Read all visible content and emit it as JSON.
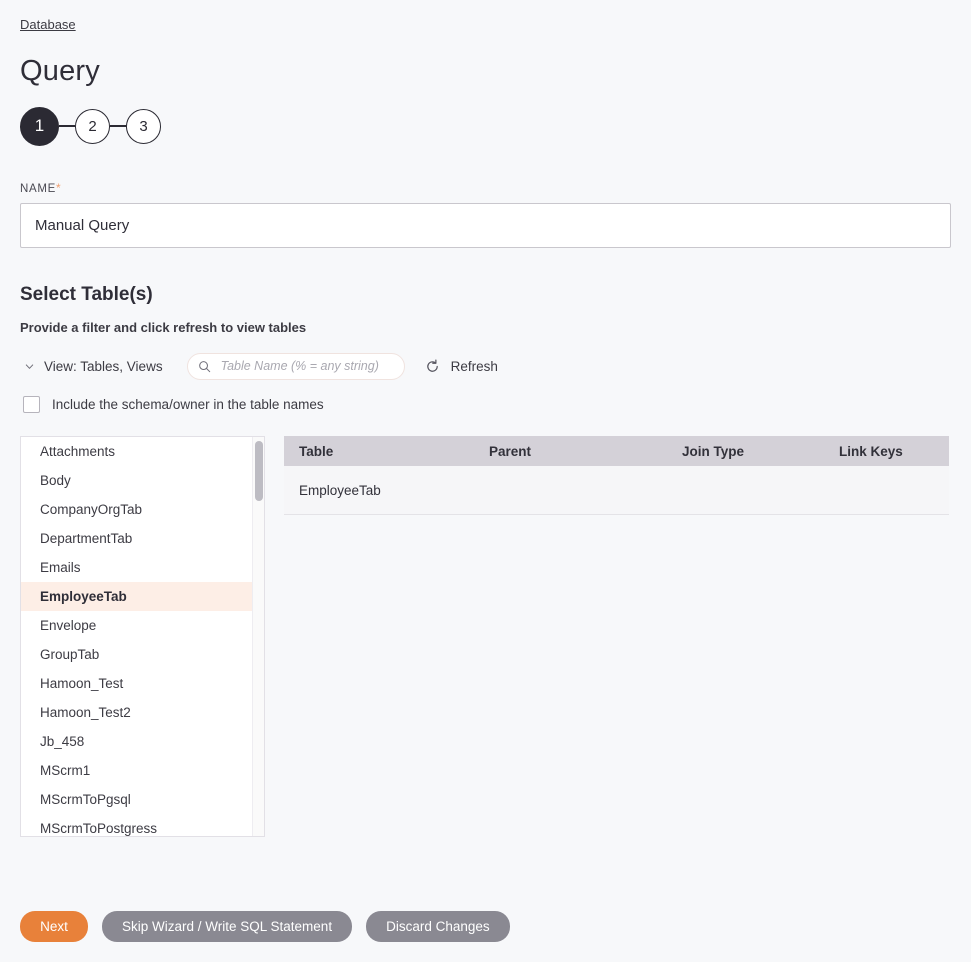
{
  "breadcrumb": {
    "label": "Database"
  },
  "header": {
    "title": "Query"
  },
  "stepper": {
    "steps": [
      {
        "label": "1",
        "state": "active"
      },
      {
        "label": "2",
        "state": "inactive"
      },
      {
        "label": "3",
        "state": "inactive"
      }
    ]
  },
  "name_field": {
    "label": "NAME",
    "required_marker": "*",
    "value": "Manual Query",
    "placeholder": ""
  },
  "select_tables": {
    "title": "Select Table(s)",
    "subtitle": "Provide a filter and click refresh to view tables",
    "view_toggle_label": "View: Tables, Views",
    "search_placeholder": "Table Name (% = any string)",
    "search_value": "",
    "refresh_label": "Refresh",
    "checkbox_label": "Include the schema/owner in the table names",
    "checkbox_checked": false
  },
  "table_list": {
    "items": [
      {
        "label": "Attachments",
        "selected": false
      },
      {
        "label": "Body",
        "selected": false
      },
      {
        "label": "CompanyOrgTab",
        "selected": false
      },
      {
        "label": "DepartmentTab",
        "selected": false
      },
      {
        "label": "Emails",
        "selected": false
      },
      {
        "label": "EmployeeTab",
        "selected": true
      },
      {
        "label": "Envelope",
        "selected": false
      },
      {
        "label": "GroupTab",
        "selected": false
      },
      {
        "label": "Hamoon_Test",
        "selected": false
      },
      {
        "label": "Hamoon_Test2",
        "selected": false
      },
      {
        "label": "Jb_458",
        "selected": false
      },
      {
        "label": "MScrm1",
        "selected": false
      },
      {
        "label": "MScrmToPgsql",
        "selected": false
      },
      {
        "label": "MScrmToPostgress",
        "selected": false
      }
    ]
  },
  "data_table": {
    "columns": [
      "Table",
      "Parent",
      "Join Type",
      "Link Keys"
    ],
    "rows": [
      {
        "table": "EmployeeTab",
        "parent": "",
        "join_type": "",
        "link_keys": ""
      }
    ]
  },
  "footer": {
    "next_label": "Next",
    "skip_label": "Skip Wizard / Write SQL Statement",
    "discard_label": "Discard Changes"
  },
  "colors": {
    "accent": "#e8813a",
    "selected_row": "#fdeee6",
    "table_header": "#d4d1d8",
    "secondary_button": "#8a8992",
    "page_background": "#f7f8fa",
    "step_active": "#2b2a33"
  }
}
